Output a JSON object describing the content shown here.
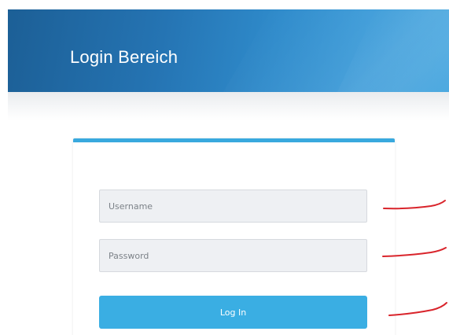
{
  "header": {
    "title": "Login Bereich"
  },
  "login_form": {
    "username_placeholder": "Username",
    "password_placeholder": "Password",
    "submit_label": "Log In"
  },
  "colors": {
    "header_gradient_start": "#1c5f96",
    "header_gradient_end": "#46a6df",
    "card_accent": "#39a9de",
    "button_background": "#3aaee3",
    "input_background": "#eef0f3",
    "annotation_marks": "#d9242b"
  }
}
